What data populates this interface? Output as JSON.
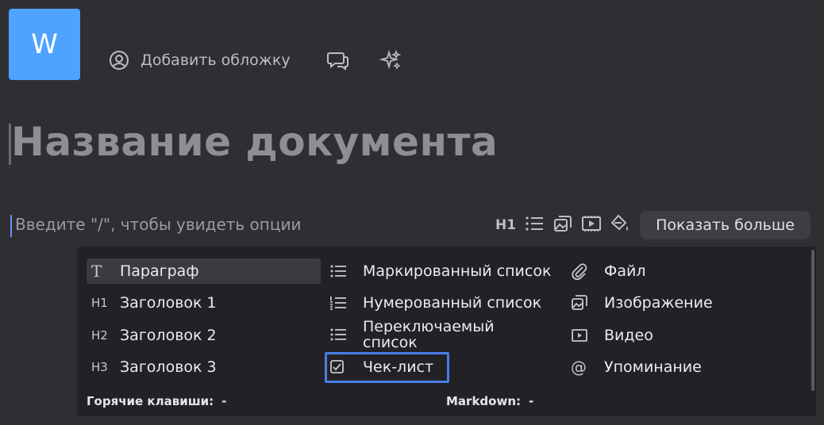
{
  "avatar": {
    "letter": "W",
    "color": "#4da3ff"
  },
  "header": {
    "add_cover_label": "Добавить обложку"
  },
  "document": {
    "title": "Название документа",
    "placeholder": "Введите \"/\", чтобы увидеть опции"
  },
  "toolbar": {
    "heading": "H1",
    "show_more": "Показать больше"
  },
  "menu": {
    "col1": [
      {
        "icon": "T",
        "label": "Параграф"
      },
      {
        "icon": "H1",
        "label": "Заголовок 1"
      },
      {
        "icon": "H2",
        "label": "Заголовок 2"
      },
      {
        "icon": "H3",
        "label": "Заголовок 3"
      }
    ],
    "col2": [
      {
        "label": "Маркированный список"
      },
      {
        "label": "Нумерованный список"
      },
      {
        "label": "Переключаемый список"
      },
      {
        "label": "Чек-лист"
      }
    ],
    "col3": [
      {
        "label": "Файл"
      },
      {
        "label": "Изображение"
      },
      {
        "label": "Видео"
      },
      {
        "label": "Упоминание"
      }
    ],
    "footer": {
      "hotkeys_label": "Горячие клавиши:",
      "hotkeys_value": "-",
      "markdown_label": "Markdown:",
      "markdown_value": "-"
    },
    "highlight_color": "#4a7ee8"
  }
}
